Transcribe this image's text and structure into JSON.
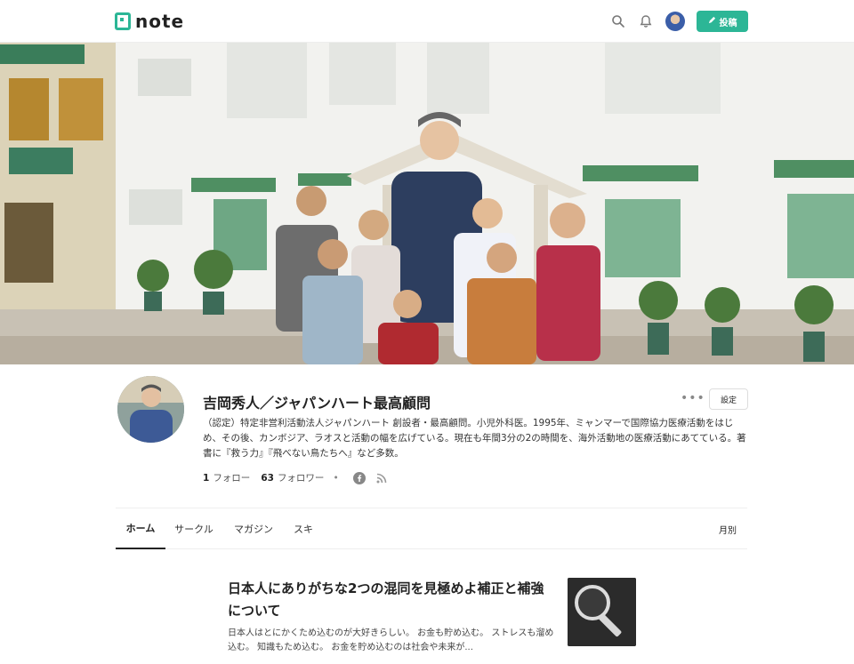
{
  "header": {
    "logo_text": "note",
    "post_button_label": "投稿",
    "icons": [
      "search-icon",
      "bell-icon",
      "avatar",
      "pencil-icon"
    ]
  },
  "profile": {
    "name": "吉岡秀人／ジャパンハート最高顧問",
    "bio": "（認定）特定非営利活動法人ジャパンハート 創設者・最高顧問。小児外科医。1995年、ミャンマーで国際協力医療活動をはじめ、その後、カンボジア、ラオスと活動の幅を広げている。現在も年間3分の2の時間を、海外活動地の医療活動にあてている。著書に『救う力』『飛べない鳥たちへ』など多数。",
    "follow_count": "1",
    "follow_label": "フォロー",
    "follower_count": "63",
    "follower_label": "フォロワー",
    "more_label": "•••",
    "settings_label": "設定",
    "social_icons": [
      "facebook-icon",
      "rss-icon"
    ]
  },
  "tabs": {
    "items": [
      "ホーム",
      "サークル",
      "マガジン",
      "スキ"
    ],
    "active": "ホーム",
    "month_label": "月別"
  },
  "article": {
    "title": "日本人にありがちな2つの混同を見極めよ補正と補強について",
    "excerpt": "日本人はとにかくため込むのが大好きらしい。 お金も貯め込む。 ストレスも溜め込む。 知識もため込む。 お金を貯め込むのは社会や未来が..."
  },
  "colors": {
    "brand": "#2cb696",
    "text": "#222222",
    "muted": "#888888",
    "divider": "#eeeeee"
  }
}
